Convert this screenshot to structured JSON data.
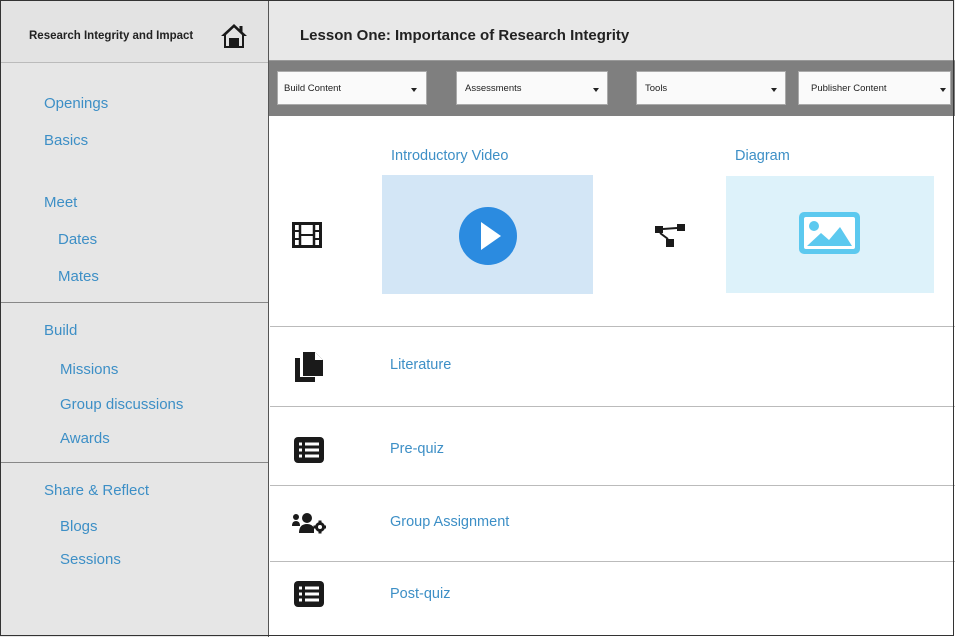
{
  "sidebar": {
    "title": "Research Integrity and Impact",
    "home_icon": "home-icon",
    "items": [
      {
        "label": "Openings"
      },
      {
        "label": "Basics"
      },
      {
        "label": "Meet"
      },
      {
        "label": "Dates"
      },
      {
        "label": "Mates"
      },
      {
        "label": "Build"
      },
      {
        "label": "Missions"
      },
      {
        "label": "Group discussions"
      },
      {
        "label": "Awards"
      },
      {
        "label": "Share & Reflect"
      },
      {
        "label": "Blogs"
      },
      {
        "label": "Sessions"
      }
    ]
  },
  "header": {
    "title": "Lesson One: Importance of Research Integrity"
  },
  "toolbar": {
    "dropdowns": [
      {
        "label": "Build Content"
      },
      {
        "label": "Assessments"
      },
      {
        "label": "Tools"
      },
      {
        "label": "Publisher Content"
      }
    ]
  },
  "content": {
    "media": {
      "video_title": "Introductory Video",
      "diagram_title": "Diagram",
      "row_icon": "film-icon",
      "diagram_icon": "flow-icon"
    },
    "items": [
      {
        "label": "Literature",
        "icon": "documents-icon"
      },
      {
        "label": "Pre-quiz",
        "icon": "list-icon"
      },
      {
        "label": "Group Assignment",
        "icon": "group-gear-icon"
      },
      {
        "label": "Post-quiz",
        "icon": "list-icon"
      }
    ]
  },
  "colors": {
    "link": "#3d8fc6",
    "sidebar_bg": "#e6e6e6",
    "toolbar_bg": "#7f7f7f",
    "video_bg": "#d3e6f6",
    "diagram_bg": "#ddf2fa",
    "play_button": "#2b8be0",
    "image_icon": "#5cc9ef"
  }
}
